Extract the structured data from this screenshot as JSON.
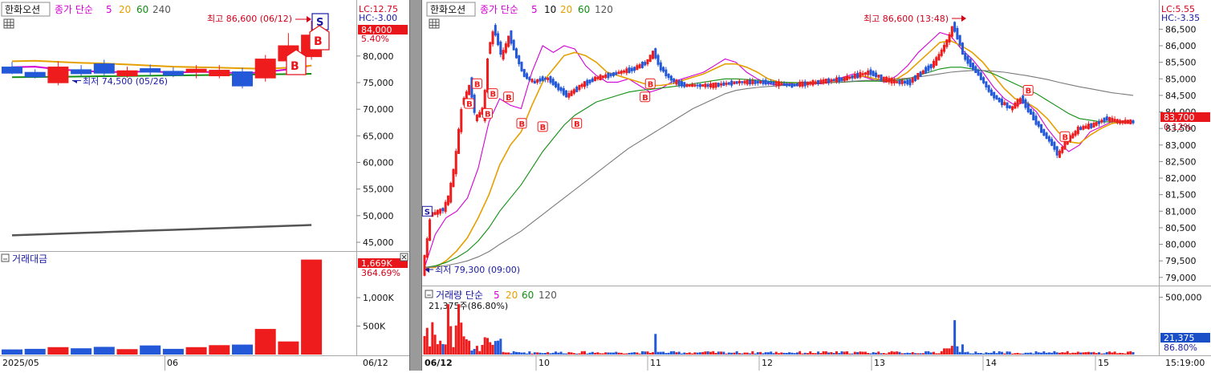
{
  "left_panel": {
    "ticker": "한화오션",
    "ma_caption": {
      "prefix": "종가 단순",
      "p1": "5",
      "p2": "20",
      "p3": "60",
      "p4": "240"
    },
    "high_annotation": "최고 86,600 (06/12)",
    "low_annotation": "최저 74,500 (05/26)",
    "lc_label": "LC:12.75",
    "hc_label": "HC:-3.00",
    "price_badge": "84,000",
    "change_pct": "5.40%",
    "volume_title": "거래대금",
    "volume_badge": "1,669K",
    "volume_change": "364.69%",
    "x_labels": [
      "2025/05",
      "06",
      "06/12"
    ]
  },
  "right_panel": {
    "ticker": "한화오션",
    "ma_caption": {
      "prefix": "종가 단순",
      "p1": "5",
      "p2": "10",
      "p3": "20",
      "p4": "60",
      "p5": "120"
    },
    "high_annotation": "최고 86,600 (13:48)",
    "low_annotation": "최저 79,300 (09:00)",
    "lc_label": "LC:5.55",
    "hc_label": "HC:-3.35",
    "price_badge": "83,700",
    "change_pct": "0.12%",
    "volume_title": "거래량 단순",
    "volume_ma": {
      "p1": "5",
      "p2": "20",
      "p3": "60",
      "p4": "120"
    },
    "volume_info": "21,375주(86.80%)",
    "volume_badge": "21,375",
    "volume_pct": "86.80%",
    "x_labels": [
      "06/12",
      "10",
      "11",
      "12",
      "13",
      "14",
      "15"
    ],
    "time_label": "15:19:00"
  },
  "colors": {
    "up": "#ee1c1c",
    "down": "#2358d8",
    "ma5": "#d400d4",
    "ma20": "#e5a000",
    "ma60": "#128f12",
    "ma120": "#7a7a7a",
    "ma240": "#555555",
    "text_blue": "#1a1aa6",
    "badge": "#e8151b"
  },
  "chart_data": [
    {
      "type": "candlestick",
      "title": "한화오션 daily",
      "y_ticks": [
        45000,
        50000,
        55000,
        60000,
        65000,
        70000,
        75000,
        80000
      ],
      "ylim": [
        43500,
        86300
      ],
      "x_labels": [
        "2025/05",
        "06",
        "06/12"
      ],
      "candles": [
        {
          "o": 78000,
          "h": 78900,
          "l": 76600,
          "c": 76700
        },
        {
          "o": 77000,
          "h": 77500,
          "l": 75800,
          "c": 76000
        },
        {
          "o": 74900,
          "h": 79000,
          "l": 74500,
          "c": 78000
        },
        {
          "o": 77500,
          "h": 78300,
          "l": 76200,
          "c": 76600
        },
        {
          "o": 78600,
          "h": 79300,
          "l": 76300,
          "c": 76700
        },
        {
          "o": 76200,
          "h": 78000,
          "l": 75900,
          "c": 77300
        },
        {
          "o": 77700,
          "h": 78400,
          "l": 76200,
          "c": 76900
        },
        {
          "o": 77200,
          "h": 77900,
          "l": 76000,
          "c": 76300
        },
        {
          "o": 76900,
          "h": 78300,
          "l": 75800,
          "c": 77600
        },
        {
          "o": 76200,
          "h": 78300,
          "l": 75800,
          "c": 77400
        },
        {
          "o": 77100,
          "h": 77800,
          "l": 73900,
          "c": 74300
        },
        {
          "o": 75800,
          "h": 80200,
          "l": 75200,
          "c": 79500
        },
        {
          "o": 79000,
          "h": 84300,
          "l": 78400,
          "c": 82000
        },
        {
          "o": 79800,
          "h": 86600,
          "l": 79300,
          "c": 84000
        }
      ],
      "ma_series": [
        {
          "name": "5",
          "values": [
            77900,
            78000,
            77500,
            77200,
            77000,
            77000,
            77100,
            76900,
            77000,
            77000,
            76700,
            77000,
            77500,
            78200
          ]
        },
        {
          "name": "20",
          "values": [
            79000,
            79100,
            78900,
            78700,
            78600,
            78400,
            78200,
            78000,
            77900,
            77800,
            77700,
            77600,
            77800,
            78200
          ]
        },
        {
          "name": "60",
          "values": [
            76000,
            76050,
            76100,
            76150,
            76200,
            76250,
            76300,
            76350,
            76400,
            76450,
            76500,
            76550,
            76600,
            76650
          ]
        },
        {
          "name": "240",
          "values": [
            46300,
            46450,
            46600,
            46750,
            46900,
            47050,
            47200,
            47350,
            47500,
            47650,
            47800,
            47950,
            48100,
            48250
          ]
        }
      ],
      "volume": {
        "title": "거래대금",
        "unit": "K",
        "y_ticks": [
          500,
          1000
        ],
        "values": [
          90,
          100,
          130,
          110,
          135,
          95,
          160,
          100,
          130,
          165,
          175,
          450,
          230,
          1669
        ]
      }
    },
    {
      "type": "candlestick",
      "title": "한화오션 intraday",
      "y_ticks": [
        79000,
        79500,
        80000,
        80500,
        81000,
        81500,
        82000,
        82500,
        83000,
        83500,
        84000,
        84500,
        85000,
        85500,
        86000,
        86500
      ],
      "ylim": [
        78850,
        86800
      ],
      "x_labels": [
        "06/12",
        "10",
        "11",
        "12",
        "13",
        "14",
        "15"
      ],
      "path_points": [
        [
          0,
          79300
        ],
        [
          3,
          80900
        ],
        [
          6,
          81000
        ],
        [
          8,
          81100
        ],
        [
          10,
          81500
        ],
        [
          12,
          82400
        ],
        [
          15,
          84300
        ],
        [
          18,
          84800
        ],
        [
          20,
          83800
        ],
        [
          23,
          84100
        ],
        [
          25,
          85900
        ],
        [
          27,
          86500
        ],
        [
          30,
          85700
        ],
        [
          33,
          86300
        ],
        [
          35,
          85800
        ],
        [
          38,
          85200
        ],
        [
          40,
          85000
        ],
        [
          42,
          84900
        ],
        [
          45,
          85000
        ],
        [
          48,
          85000
        ],
        [
          52,
          84700
        ],
        [
          55,
          84500
        ],
        [
          60,
          84800
        ],
        [
          65,
          85000
        ],
        [
          70,
          85100
        ],
        [
          75,
          85200
        ],
        [
          80,
          85300
        ],
        [
          85,
          85500
        ],
        [
          88,
          85800
        ],
        [
          90,
          85400
        ],
        [
          93,
          85100
        ],
        [
          96,
          84900
        ],
        [
          100,
          84800
        ],
        [
          110,
          84800
        ],
        [
          120,
          84900
        ],
        [
          130,
          84900
        ],
        [
          140,
          84800
        ],
        [
          150,
          84900
        ],
        [
          160,
          85000
        ],
        [
          165,
          85100
        ],
        [
          170,
          85200
        ],
        [
          175,
          85000
        ],
        [
          180,
          84900
        ],
        [
          185,
          84900
        ],
        [
          190,
          85200
        ],
        [
          195,
          85500
        ],
        [
          198,
          85900
        ],
        [
          200,
          86200
        ],
        [
          202,
          86600
        ],
        [
          204,
          86200
        ],
        [
          206,
          85700
        ],
        [
          208,
          85500
        ],
        [
          212,
          85100
        ],
        [
          216,
          84600
        ],
        [
          220,
          84300
        ],
        [
          224,
          84100
        ],
        [
          228,
          84400
        ],
        [
          232,
          83900
        ],
        [
          236,
          83400
        ],
        [
          240,
          83000
        ],
        [
          242,
          82700
        ],
        [
          245,
          83100
        ],
        [
          250,
          83500
        ],
        [
          255,
          83600
        ],
        [
          260,
          83800
        ],
        [
          265,
          83700
        ],
        [
          270,
          83700
        ]
      ],
      "ma_series": [
        {
          "name": "5",
          "values": [
            79300,
            80300,
            80800,
            81000,
            81400,
            82300,
            83700,
            84400,
            84200,
            84100,
            85200,
            86000,
            85800,
            86000,
            85900,
            85400,
            85100,
            84900,
            84900,
            85000,
            84800,
            84600,
            84700,
            84900,
            85000,
            85100,
            85200,
            85400,
            85600,
            85500,
            85200,
            85000,
            84850,
            84800,
            84850,
            84900,
            84850,
            84850,
            84950,
            85050,
            85150,
            85050,
            84950,
            84900,
            85100,
            85400,
            85800,
            86100,
            86400,
            86300,
            85900,
            85600,
            85200,
            84750,
            84400,
            84200,
            84300,
            84000,
            83500,
            83100,
            82800,
            83000,
            83400,
            83550,
            83700,
            83700,
            83700
          ]
        },
        {
          "name": "20",
          "values": [
            79300,
            79300,
            79500,
            79800,
            80200,
            80800,
            81500,
            82400,
            83000,
            83400,
            84200,
            84900,
            85300,
            85700,
            85800,
            85700,
            85500,
            85200,
            85100,
            85000,
            84900,
            84800,
            84800,
            84850,
            84950,
            85050,
            85150,
            85300,
            85450,
            85450,
            85350,
            85200,
            85000,
            84900,
            84880,
            84880,
            84880,
            84870,
            84900,
            84980,
            85080,
            85080,
            85000,
            84950,
            85000,
            85200,
            85500,
            85800,
            86100,
            86150,
            86000,
            85800,
            85500,
            85100,
            84700,
            84400,
            84300,
            84100,
            83800,
            83400,
            83100,
            83050,
            83300,
            83500,
            83650,
            83700,
            83700
          ]
        },
        {
          "name": "60",
          "values": [
            79300,
            79350,
            79450,
            79600,
            79800,
            80100,
            80500,
            81000,
            81400,
            81800,
            82300,
            82800,
            83200,
            83600,
            83900,
            84100,
            84300,
            84400,
            84500,
            84600,
            84650,
            84680,
            84720,
            84760,
            84800,
            84850,
            84900,
            84950,
            85000,
            85000,
            84980,
            84960,
            84930,
            84900,
            84890,
            84880,
            84880,
            84880,
            84890,
            84900,
            84920,
            84930,
            84930,
            84930,
            84950,
            85000,
            85100,
            85200,
            85300,
            85350,
            85350,
            85300,
            85250,
            85150,
            85000,
            84850,
            84700,
            84550,
            84350,
            84150,
            83950,
            83800,
            83750,
            83700,
            83700,
            83700,
            83700
          ]
        },
        {
          "name": "120",
          "values": [
            79300,
            79320,
            79360,
            79420,
            79500,
            79620,
            79780,
            80000,
            80200,
            80400,
            80650,
            80900,
            81150,
            81400,
            81650,
            81900,
            82150,
            82400,
            82650,
            82900,
            83100,
            83300,
            83500,
            83700,
            83900,
            84100,
            84250,
            84400,
            84550,
            84650,
            84700,
            84740,
            84770,
            84790,
            84810,
            84830,
            84850,
            84870,
            84890,
            84910,
            84930,
            84950,
            84960,
            84970,
            84990,
            85020,
            85060,
            85100,
            85150,
            85200,
            85230,
            85250,
            85250,
            85230,
            85200,
            85150,
            85100,
            85040,
            84980,
            84900,
            84830,
            84760,
            84700,
            84640,
            84580,
            84540,
            84500
          ]
        }
      ],
      "volume": {
        "title": "거래량",
        "unit": "주",
        "y_ticks": [
          500000
        ],
        "last": 21375
      }
    }
  ]
}
